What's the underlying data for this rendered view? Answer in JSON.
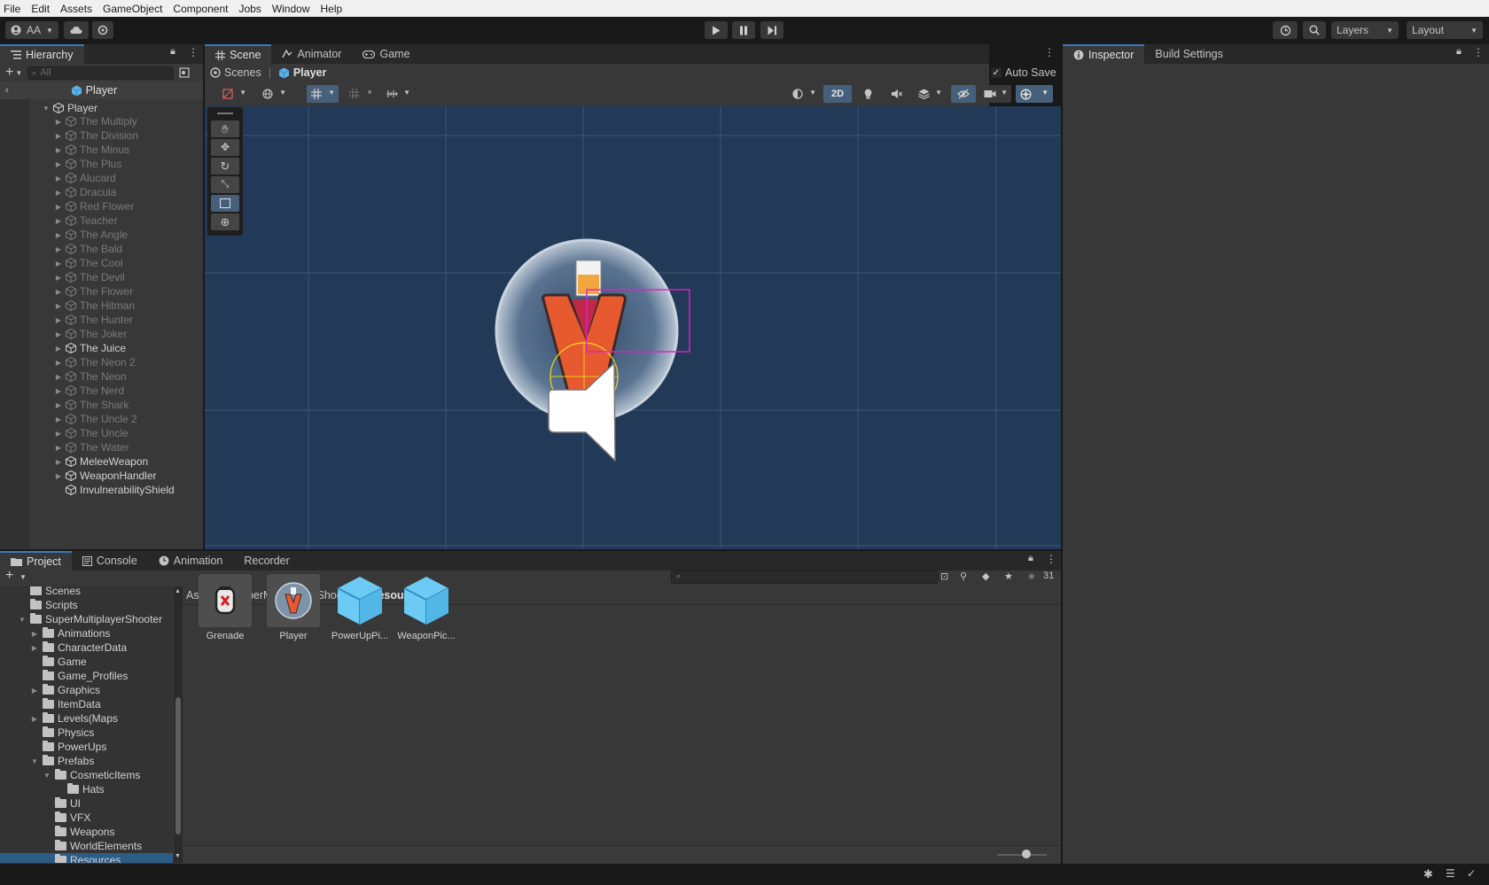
{
  "menu": [
    "File",
    "Edit",
    "Assets",
    "GameObject",
    "Component",
    "Jobs",
    "Window",
    "Help"
  ],
  "toolbar": {
    "account": "AA",
    "layers": "Layers",
    "layout": "Layout"
  },
  "hierarchy": {
    "tab": "Hierarchy",
    "search_placeholder": "All",
    "breadcrumb": "Player",
    "root": "Player",
    "children": [
      {
        "label": "The Multiply",
        "bright": false
      },
      {
        "label": "The Division",
        "bright": false
      },
      {
        "label": "The Minus",
        "bright": false
      },
      {
        "label": "The Plus",
        "bright": false
      },
      {
        "label": "Alucard",
        "bright": false
      },
      {
        "label": "Dracula",
        "bright": false
      },
      {
        "label": "Red Flower",
        "bright": false
      },
      {
        "label": "Teacher",
        "bright": false
      },
      {
        "label": "The Angle",
        "bright": false
      },
      {
        "label": "The Bald",
        "bright": false
      },
      {
        "label": "The Cool",
        "bright": false
      },
      {
        "label": "The Devil",
        "bright": false
      },
      {
        "label": "The Flower",
        "bright": false
      },
      {
        "label": "The Hitman",
        "bright": false
      },
      {
        "label": "The Hunter",
        "bright": false
      },
      {
        "label": "The Joker",
        "bright": false
      },
      {
        "label": "The Juice",
        "bright": true
      },
      {
        "label": "The Neon 2",
        "bright": false
      },
      {
        "label": "The Neon",
        "bright": false
      },
      {
        "label": "The Nerd",
        "bright": false
      },
      {
        "label": "The Shark",
        "bright": false
      },
      {
        "label": "The Uncle 2",
        "bright": false
      },
      {
        "label": "The Uncle",
        "bright": false
      },
      {
        "label": "The Water",
        "bright": false
      },
      {
        "label": "MeleeWeapon",
        "bright": true
      },
      {
        "label": "WeaponHandler",
        "bright": true
      },
      {
        "label": "InvulnerabilityShield",
        "bright": true
      }
    ]
  },
  "scene": {
    "tabs": [
      "Scene",
      "Animator",
      "Game"
    ],
    "breadcrumb_root": "Scenes",
    "breadcrumb_current": "Player",
    "auto_save": "Auto Save",
    "mode_2d": "2D"
  },
  "inspector": {
    "tabs": [
      "Inspector",
      "Build Settings"
    ]
  },
  "project": {
    "tabs": [
      "Project",
      "Console",
      "Animation",
      "Recorder"
    ],
    "count": "31",
    "path": [
      "Assets",
      "SuperMultiplayerShooter",
      "Resources"
    ],
    "tree": [
      {
        "label": "Scenes",
        "indent": 0,
        "arrow": ""
      },
      {
        "label": "Scripts",
        "indent": 0,
        "arrow": ""
      },
      {
        "label": "SuperMultiplayerShooter",
        "indent": 0,
        "arrow": "open"
      },
      {
        "label": "Animations",
        "indent": 1,
        "arrow": "closed"
      },
      {
        "label": "CharacterData",
        "indent": 1,
        "arrow": "closed"
      },
      {
        "label": "Game",
        "indent": 1,
        "arrow": ""
      },
      {
        "label": "Game_Profiles",
        "indent": 1,
        "arrow": ""
      },
      {
        "label": "Graphics",
        "indent": 1,
        "arrow": "closed"
      },
      {
        "label": "ItemData",
        "indent": 1,
        "arrow": ""
      },
      {
        "label": "Levels(Maps",
        "indent": 1,
        "arrow": "closed"
      },
      {
        "label": "Physics",
        "indent": 1,
        "arrow": ""
      },
      {
        "label": "PowerUps",
        "indent": 1,
        "arrow": ""
      },
      {
        "label": "Prefabs",
        "indent": 1,
        "arrow": "open"
      },
      {
        "label": "CosmeticItems",
        "indent": 2,
        "arrow": "open"
      },
      {
        "label": "Hats",
        "indent": 3,
        "arrow": ""
      },
      {
        "label": "UI",
        "indent": 2,
        "arrow": ""
      },
      {
        "label": "VFX",
        "indent": 2,
        "arrow": ""
      },
      {
        "label": "Weapons",
        "indent": 2,
        "arrow": ""
      },
      {
        "label": "WorldElements",
        "indent": 2,
        "arrow": ""
      },
      {
        "label": "Resources",
        "indent": 1,
        "arrow": ""
      }
    ],
    "assets": [
      "Grenade",
      "Player",
      "PowerUpPi...",
      "WeaponPic..."
    ]
  }
}
